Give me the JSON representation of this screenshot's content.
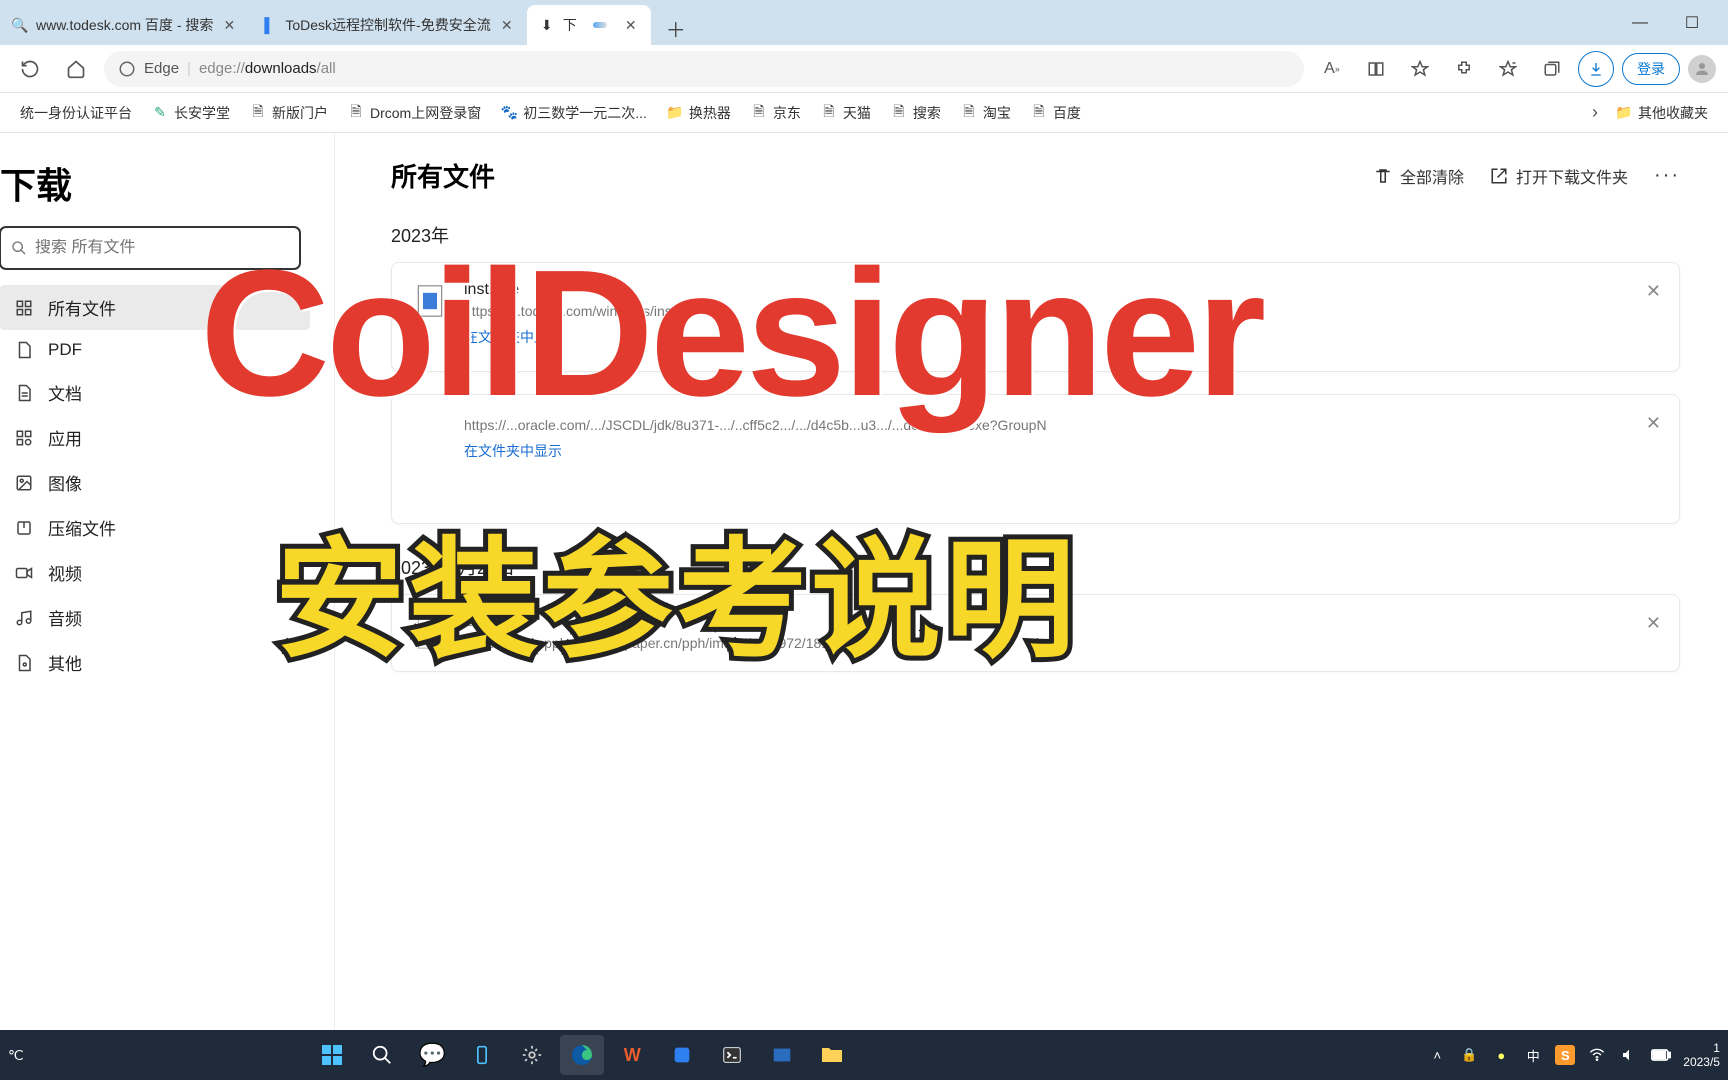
{
  "tabs": [
    {
      "title": "www.todesk.com 百度 - 搜索",
      "icon": "search"
    },
    {
      "title": "ToDesk远程控制软件-免费安全流",
      "icon": "todesk"
    },
    {
      "title": "下载",
      "icon": "download",
      "active": true
    }
  ],
  "address": {
    "browser_label": "Edge",
    "url_prefix": "edge://",
    "url_mid": "downloads",
    "url_suffix": "/all",
    "login": "登录"
  },
  "bookmarks": [
    {
      "label": "统一身份认证平台"
    },
    {
      "label": "长安学堂"
    },
    {
      "label": "新版门户"
    },
    {
      "label": "Drcom上网登录窗"
    },
    {
      "label": "初三数学一元二次..."
    },
    {
      "label": "换热器"
    },
    {
      "label": "京东"
    },
    {
      "label": "天猫"
    },
    {
      "label": "搜索"
    },
    {
      "label": "淘宝"
    },
    {
      "label": "百度"
    }
  ],
  "bookmarks_other": "其他收藏夹",
  "sidebar": {
    "title": "下载",
    "search_placeholder": "搜索 所有文件",
    "items": [
      {
        "label": "所有文件",
        "icon": "grid",
        "active": true
      },
      {
        "label": "PDF",
        "icon": "pdf"
      },
      {
        "label": "文档",
        "icon": "doc"
      },
      {
        "label": "应用",
        "icon": "app"
      },
      {
        "label": "图像",
        "icon": "image"
      },
      {
        "label": "压缩文件",
        "icon": "zip"
      },
      {
        "label": "视频",
        "icon": "video"
      },
      {
        "label": "音频",
        "icon": "audio"
      },
      {
        "label": "其他",
        "icon": "other"
      }
    ]
  },
  "content": {
    "title": "所有文件",
    "clear_all": "全部清除",
    "open_folder": "打开下载文件夹",
    "groups": [
      {
        "date": "2023年",
        "items": [
          {
            "name": "inst.exe",
            "url": "https://dl.todesk.com/windows/inst.exe",
            "show_in_folder": "在文件夹中显示"
          },
          {
            "name": "",
            "url": "https://...oracle.com/.../JSCDL/jdk/8u371-.../..cff5c2.../.../d4c5b...u3.../...dows-x64.exe?GroupN",
            "show_in_folder": "在文件夹中显示"
          }
        ]
      },
      {
        "date": "2023年4月23日",
        "items": [
          {
            "name": "181.jpg",
            "url": "https://imagepphcloud.thepaper.cn/pph/image/196/972/181.jpg",
            "show_in_folder": ""
          }
        ]
      }
    ]
  },
  "overlay": {
    "line1": "CoilDesigner",
    "line2": "安装参考说明"
  },
  "taskbar": {
    "temp": "℃",
    "time": "1",
    "date": "2023/5",
    "ime": "中"
  }
}
